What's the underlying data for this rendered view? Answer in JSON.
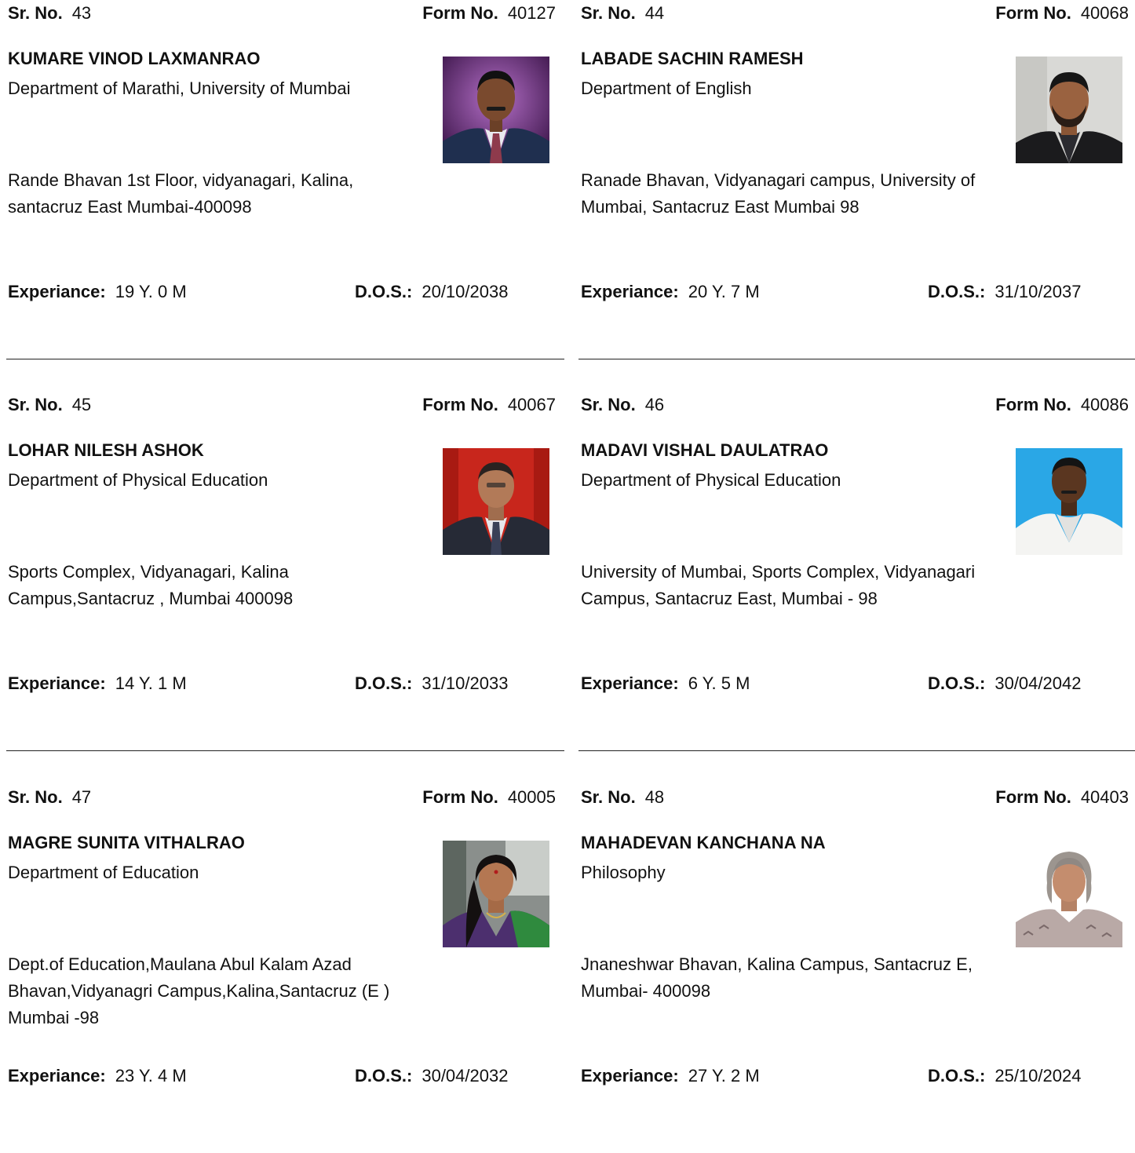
{
  "labels": {
    "sr_no": "Sr. No.",
    "form_no": "Form No.",
    "experience": "Experiance:",
    "dos": "D.O.S.:"
  },
  "entries": [
    {
      "sr_no": "43",
      "form_no": "40127",
      "name": "KUMARE VINOD LAXMANRAO",
      "department": "Department of Marathi, University of Mumbai",
      "address": "Rande Bhavan 1st Floor, vidyanagari, Kalina, santacruz East Mumbai-400098",
      "experience": "19 Y. 0 M",
      "dos": "20/10/2038",
      "photo": "man-purple-background-photo"
    },
    {
      "sr_no": "44",
      "form_no": "40068",
      "name": "LABADE SACHIN RAMESH",
      "department": "Department of English",
      "address": "Ranade Bhavan, Vidyanagari campus, University of Mumbai, Santacruz East Mumbai 98",
      "experience": "20 Y. 7 M",
      "dos": "31/10/2037",
      "photo": "man-bearded-photo"
    },
    {
      "sr_no": "45",
      "form_no": "40067",
      "name": "LOHAR NILESH ASHOK",
      "department": "Department of Physical Education",
      "address": "Sports Complex, Vidyanagari, Kalina Campus,Santacruz , Mumbai 400098",
      "experience": "14 Y. 1 M",
      "dos": "31/10/2033",
      "photo": "man-red-background-photo"
    },
    {
      "sr_no": "46",
      "form_no": "40086",
      "name": "MADAVI VISHAL DAULATRAO",
      "department": "Department of Physical Education",
      "address": "University of Mumbai, Sports Complex, Vidyanagari Campus, Santacruz East, Mumbai - 98",
      "experience": "6 Y. 5 M",
      "dos": "30/04/2042",
      "photo": "man-blue-background-photo"
    },
    {
      "sr_no": "47",
      "form_no": "40005",
      "name": "MAGRE SUNITA VITHALRAO",
      "department": "Department of Education",
      "address": "Dept.of Education,Maulana Abul Kalam Azad Bhavan,Vidyanagri Campus,Kalina,Santacruz (E ) Mumbai -98",
      "experience": "23 Y. 4 M",
      "dos": "30/04/2032",
      "photo": "woman-saree-photo"
    },
    {
      "sr_no": "48",
      "form_no": "40403",
      "name": "MAHADEVAN KANCHANA NA",
      "department": "Philosophy",
      "address": "Jnaneshwar Bhavan, Kalina Campus, Santacruz E, Mumbai- 400098",
      "experience": "27 Y. 2 M",
      "dos": "25/10/2024",
      "photo": "woman-grey-hair-photo"
    }
  ]
}
